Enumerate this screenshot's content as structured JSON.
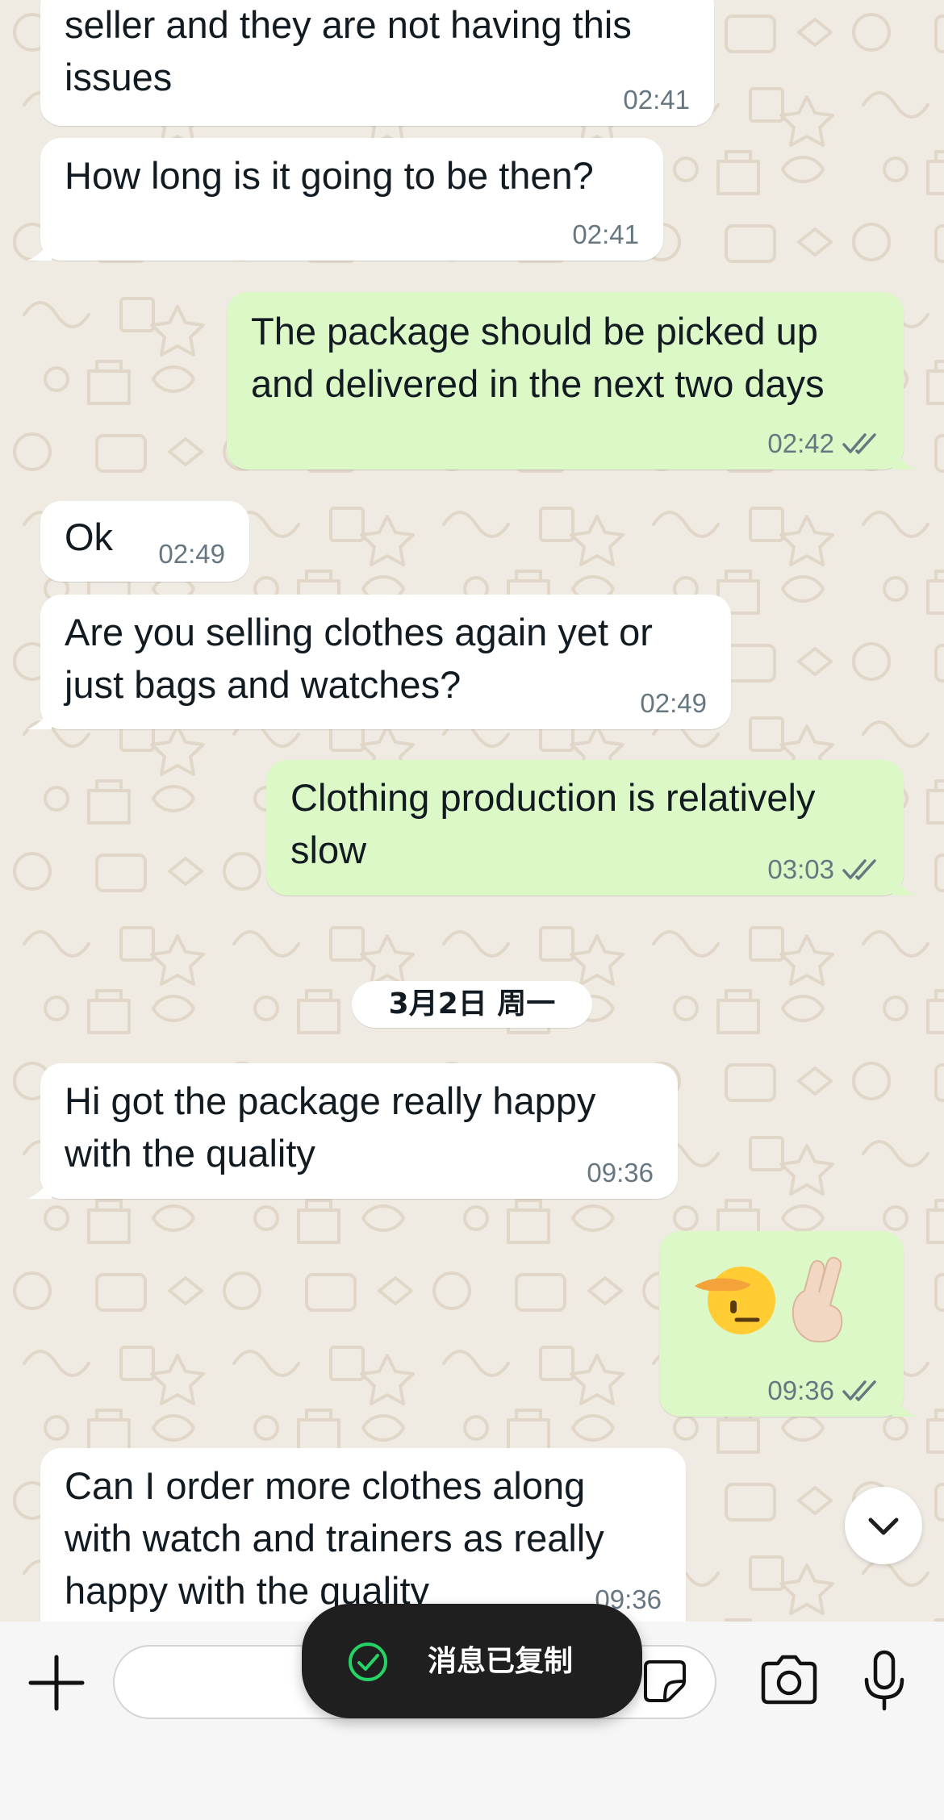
{
  "date_divider": "3月2日 周一",
  "messages": [
    {
      "direction": "incoming",
      "lines": [
        "seller and they are not having this",
        "issues"
      ],
      "time": "02:41"
    },
    {
      "direction": "incoming",
      "lines": [
        "How long is it going to be then?"
      ],
      "time": "02:41"
    },
    {
      "direction": "outgoing",
      "lines": [
        "The package should be picked up",
        "and delivered in the next two days"
      ],
      "time": "02:42",
      "status": "read"
    },
    {
      "direction": "incoming",
      "lines": [
        "Ok"
      ],
      "time": "02:49"
    },
    {
      "direction": "incoming",
      "lines": [
        "Are you selling clothes again yet or",
        "just bags and watches?"
      ],
      "time": "02:49"
    },
    {
      "direction": "outgoing",
      "lines": [
        "Clothing production is relatively",
        "slow"
      ],
      "time": "03:03",
      "status": "read"
    },
    {
      "direction": "incoming",
      "lines": [
        "Hi got the package really happy",
        "with the quality"
      ],
      "time": "09:36"
    },
    {
      "direction": "outgoing",
      "emoji": [
        "saluting-face",
        "hand-with-index-finger-and-thumb-crossed"
      ],
      "time": "09:36",
      "status": "read"
    },
    {
      "direction": "incoming",
      "lines": [
        "Can I order more clothes along",
        "with watch and trainers as really",
        "happy with the quality"
      ],
      "time": "09:36"
    }
  ],
  "toast": {
    "text": "消息已复制",
    "icon": "check-circle-icon"
  },
  "input_bar": {
    "icons": [
      "plus-icon",
      "sticker-icon",
      "camera-icon",
      "microphone-icon"
    ]
  },
  "colors": {
    "incoming_bubble": "#ffffff",
    "outgoing_bubble": "#dcf8c6",
    "chat_background": "#efeae2",
    "toast_background": "#1f1f1f",
    "tick_color": "#667781",
    "toast_check": "#25d366"
  }
}
